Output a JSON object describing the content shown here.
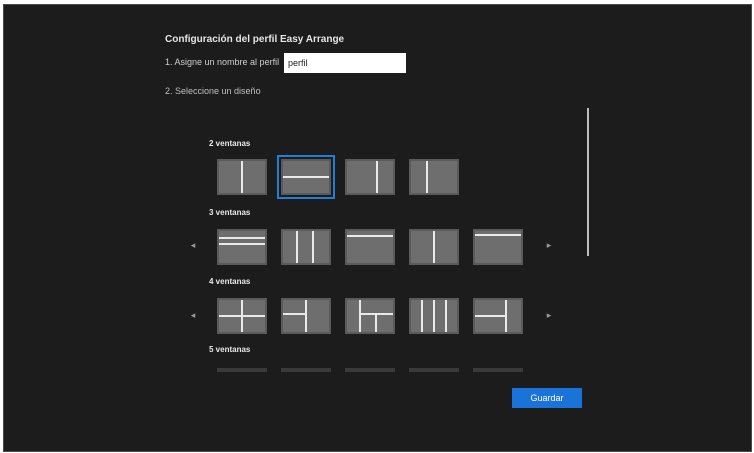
{
  "dialog": {
    "title": "Configuración del perfil Easy Arrange",
    "name_label": "1. Asigne un nombre al perfil",
    "name_value": "perfil",
    "select_label": "2. Seleccione un diseño",
    "save_label": "Guardar"
  },
  "groups": [
    {
      "label": "2 ventanas"
    },
    {
      "label": "3 ventanas"
    },
    {
      "label": "4 ventanas"
    },
    {
      "label": "5 ventanas"
    }
  ],
  "icons": {
    "prev": "chevron-left-icon",
    "next": "chevron-right-icon"
  },
  "colors": {
    "accent": "#1a73d9",
    "background": "#1c1c1c",
    "tile": "#6e6e6e",
    "divider": "#e9e9e9"
  }
}
